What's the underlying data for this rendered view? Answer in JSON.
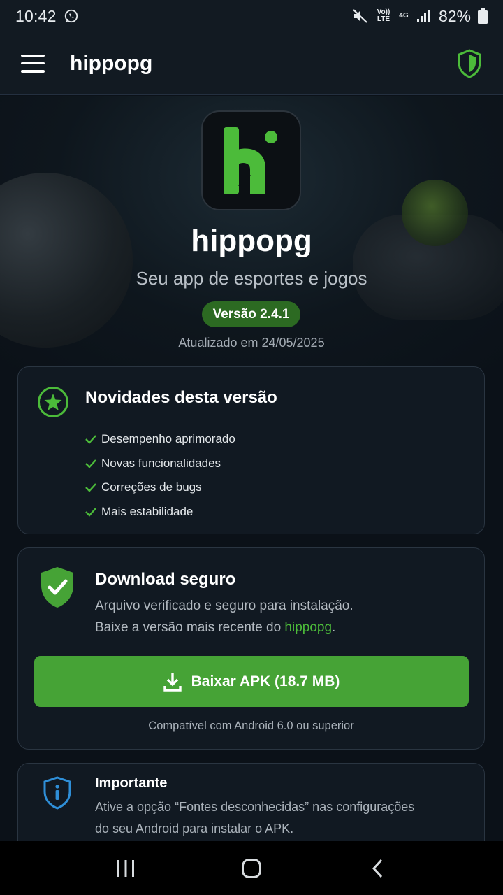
{
  "status_bar": {
    "time": "10:42",
    "battery": "82%",
    "network": "4G",
    "volte": "Vo)) LTE"
  },
  "app_bar": {
    "title": "hippopg"
  },
  "hero": {
    "app_name": "hippopg",
    "tagline": "Seu app de esportes e jogos",
    "version": "Versão 2.4.1",
    "updated": "Atualizado em 24/05/2025"
  },
  "news": {
    "title": "Novidades desta versão",
    "items": [
      "Desempenho aprimorado",
      "Novas funcionalidades",
      "Correções de bugs",
      "Mais estabilidade"
    ]
  },
  "download": {
    "title": "Download seguro",
    "desc1": "Arquivo verificado e seguro para instalação.",
    "desc2_prefix": "Baixe a versão mais recente do ",
    "desc2_highlight": "hippopg",
    "desc2_suffix": ".",
    "button_label": "Baixar APK (18.7 MB)",
    "compat": "Compatível com Android 6.0 ou superior"
  },
  "important": {
    "title": "Importante",
    "line1": "Ative a opção “Fontes desconhecidas” nas configurações",
    "line2": "do seu Android para instalar o APK."
  },
  "colors": {
    "accent_green": "#46a336",
    "badge_green": "#2c6a22",
    "info_blue": "#2f8fd8",
    "background": "#0b1118"
  },
  "icons": [
    "whatsapp-icon",
    "mute-icon",
    "signal-icon",
    "battery-icon",
    "menu-icon",
    "shield-icon",
    "star-icon",
    "check-icon",
    "shield-check-icon",
    "download-icon",
    "info-shield-icon",
    "recents-icon",
    "home-icon",
    "back-icon"
  ]
}
